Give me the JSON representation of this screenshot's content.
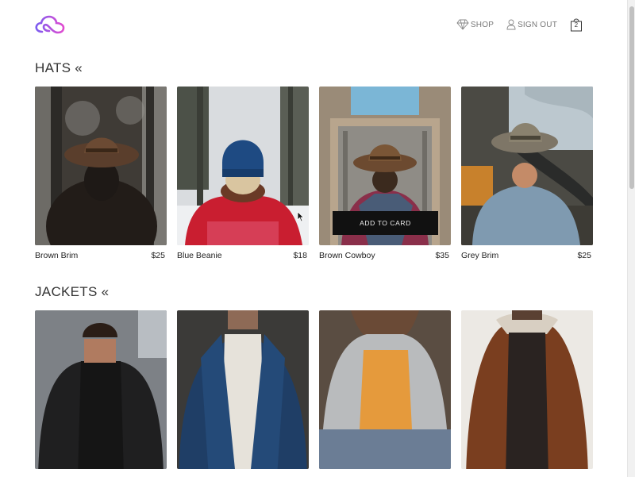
{
  "header": {
    "nav": {
      "shop": "SHOP",
      "sign_out": "SIGN OUT",
      "cart_count": "2"
    }
  },
  "sections": [
    {
      "title": "HATS «",
      "items": [
        {
          "name": "Brown Brim",
          "price": "$25"
        },
        {
          "name": "Blue Beanie",
          "price": "$18"
        },
        {
          "name": "Brown Cowboy",
          "price": "$35",
          "button": "ADD TO CARD"
        },
        {
          "name": "Grey Brim",
          "price": "$25"
        }
      ]
    },
    {
      "title": "JACKETS «",
      "items": [
        {
          "name": "",
          "price": ""
        },
        {
          "name": "",
          "price": ""
        },
        {
          "name": "",
          "price": ""
        },
        {
          "name": "",
          "price": ""
        }
      ]
    }
  ],
  "colors": {
    "logo_gradient_start": "#7b5cf0",
    "logo_gradient_end": "#e14bd0",
    "button_bg": "#111111"
  },
  "icons": [
    "cloud-logo-icon",
    "diamond-icon",
    "user-icon",
    "shopping-bag-icon",
    "mouse-cursor-icon"
  ]
}
